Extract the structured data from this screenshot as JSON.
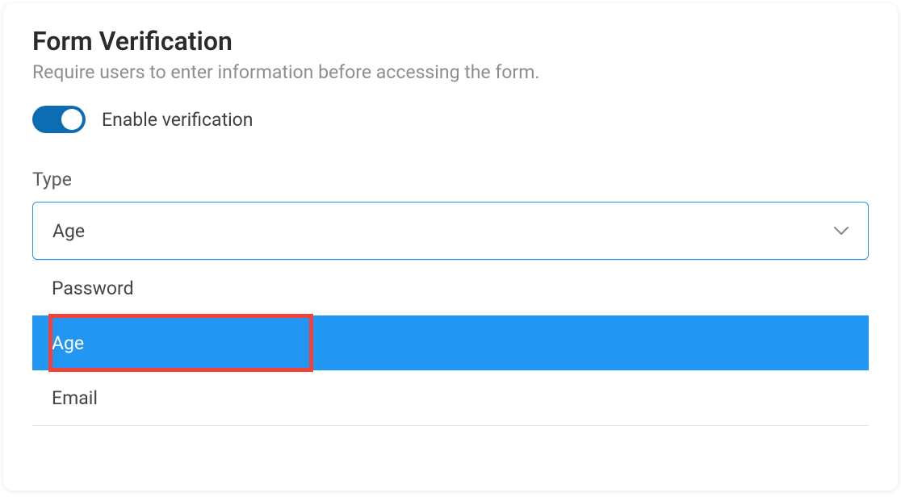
{
  "form_verification": {
    "title": "Form Verification",
    "subtitle": "Require users to enter information before accessing the form.",
    "toggle": {
      "label": "Enable verification",
      "enabled": true
    },
    "type_field": {
      "label": "Type",
      "selected_value": "Age",
      "options": [
        {
          "label": "Password",
          "selected": false
        },
        {
          "label": "Age",
          "selected": true
        },
        {
          "label": "Email",
          "selected": false
        }
      ]
    }
  },
  "colors": {
    "toggle_on": "#0d6db3",
    "select_border": "#2196f3",
    "option_selected_bg": "#2196f3",
    "highlight_border": "#f44336"
  }
}
